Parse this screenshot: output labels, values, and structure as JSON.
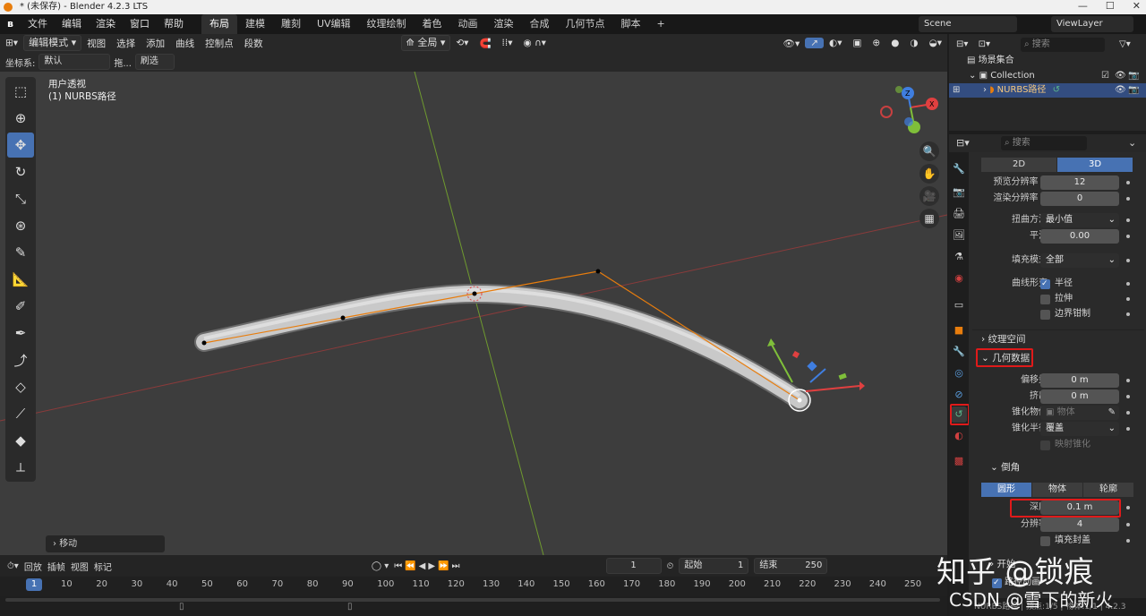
{
  "titlebar": {
    "title": "* (未保存) - Blender 4.2.3 LTS",
    "controls": [
      "—",
      "☐",
      "✕"
    ]
  },
  "menubar": {
    "menus": [
      "文件",
      "编辑",
      "渲染",
      "窗口",
      "帮助"
    ],
    "workspaces": [
      "布局",
      "建模",
      "雕刻",
      "UV编辑",
      "纹理绘制",
      "着色",
      "动画",
      "渲染",
      "合成",
      "几何节点",
      "脚本"
    ],
    "add_tab": "+",
    "scene": "Scene",
    "viewlayer": "ViewLayer"
  },
  "viewport_header": {
    "mode": "编辑模式",
    "menus": [
      "视图",
      "选择",
      "添加",
      "曲线",
      "控制点",
      "段数"
    ],
    "transform_orientation": "全局",
    "coord_label": "坐标系:",
    "coord_value": "默认",
    "drag_label": "拖...",
    "drag_value": "刷选"
  },
  "viewport": {
    "view_name": "用户透视",
    "object_name": "(1) NURBS路径",
    "last_op": "移动",
    "gizmo": {
      "x": "X",
      "y": "Y",
      "z": "Z"
    }
  },
  "timeline": {
    "menus": [
      "回放",
      "插帧",
      "视图",
      "标记"
    ],
    "current_frame": "1",
    "start_label": "起始",
    "start_value": "1",
    "end_label": "结束",
    "end_value": "250",
    "ticks": [
      "10",
      "20",
      "30",
      "40",
      "50",
      "60",
      "70",
      "80",
      "90",
      "100",
      "110",
      "120",
      "130",
      "140",
      "150",
      "160",
      "170",
      "180",
      "190",
      "200",
      "210",
      "220",
      "230",
      "240",
      "250"
    ],
    "status": "NURBS路径 | 顶点:1/5 | 物体:1/1 | 4.2.3"
  },
  "outliner": {
    "search_placeholder": "搜索",
    "scene_collection": "场景集合",
    "collection": "Collection",
    "object": "NURBS路径"
  },
  "properties": {
    "search_placeholder": "搜索",
    "dim_2d": "2D",
    "dim_3d": "3D",
    "preview_res_label": "预览分辨率 U",
    "preview_res_value": "12",
    "render_res_label": "渲染分辨率 U",
    "render_res_value": "0",
    "twist_label": "扭曲方法",
    "twist_value": "最小值",
    "smooth_label": "平滑",
    "smooth_value": "0.00",
    "fill_label": "填充模式",
    "fill_value": "全部",
    "deform_label": "曲线形变",
    "radius_label": "半径",
    "stretch_label": "拉伸",
    "bounds_label": "边界钳制",
    "texture_space": "纹理空间",
    "geometry": "几何数据",
    "offset_label": "偏移量",
    "offset_value": "0 m",
    "extrude_label": "挤出",
    "extrude_value": "0 m",
    "taper_obj_label": "锥化物体",
    "taper_obj_placeholder": "物体",
    "taper_radius_label": "锥化半径",
    "taper_radius_value": "覆盖",
    "map_taper_label": "映射锥化",
    "bevel": "倒角",
    "bevel_modes": [
      "圆形",
      "物体",
      "轮廓"
    ],
    "depth_label": "深度",
    "depth_value": "0.1 m",
    "resolution_label": "分辨率",
    "resolution_value": "4",
    "fill_caps_label": "填充封盖",
    "start_mapping": "开始",
    "path_anim_label": "路径动画"
  },
  "watermark": {
    "line1": "知乎 @锁痕",
    "line2": "CSDN @雪下的新火"
  },
  "colors": {
    "accent": "#4772b3",
    "highlight_box": "#e01a1a",
    "curve": "#e87d0d",
    "header": "#282828"
  }
}
